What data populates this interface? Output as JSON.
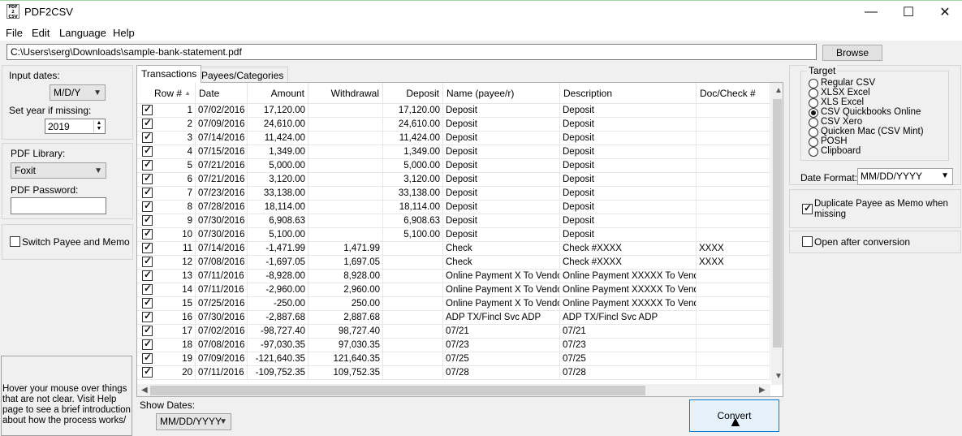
{
  "window": {
    "title": "PDF2CSV",
    "icon_text": "PDF 2 CSV",
    "minimize": "—",
    "maximize": "☐",
    "close": "✕"
  },
  "menu": [
    "File",
    "Edit",
    "Language",
    "Help"
  ],
  "path": {
    "value": "C:\\Users\\serg\\Downloads\\sample-bank-statement.pdf",
    "browse_label": "Browse"
  },
  "left": {
    "input_dates_label": "Input dates:",
    "input_dates_value": "M/D/Y",
    "year_label": "Set year if missing:",
    "year_value": "2019",
    "pdf_library_label": "PDF Library:",
    "pdf_library_value": "Foxit",
    "pdf_password_label": "PDF Password:",
    "pdf_password_value": "",
    "switch_label": "Switch Payee and Memo",
    "switch_checked": false,
    "help_text": "Hover your mouse over things that are not clear. Visit Help page to see a brief introduction about how the process works/"
  },
  "tabs": [
    "Transactions",
    "Payees/Categories"
  ],
  "table": {
    "columns": [
      "Row #",
      "Date",
      "Amount",
      "Withdrawal",
      "Deposit",
      "Name (payee/r)",
      "Description",
      "Doc/Check #"
    ],
    "rows": [
      [
        "1",
        "07/02/2016",
        "17,120.00",
        "",
        "17,120.00",
        "Deposit",
        "Deposit",
        ""
      ],
      [
        "2",
        "07/09/2016",
        "24,610.00",
        "",
        "24,610.00",
        "Deposit",
        "Deposit",
        ""
      ],
      [
        "3",
        "07/14/2016",
        "11,424.00",
        "",
        "11,424.00",
        "Deposit",
        "Deposit",
        ""
      ],
      [
        "4",
        "07/15/2016",
        "1,349.00",
        "",
        "1,349.00",
        "Deposit",
        "Deposit",
        ""
      ],
      [
        "5",
        "07/21/2016",
        "5,000.00",
        "",
        "5,000.00",
        "Deposit",
        "Deposit",
        ""
      ],
      [
        "6",
        "07/21/2016",
        "3,120.00",
        "",
        "3,120.00",
        "Deposit",
        "Deposit",
        ""
      ],
      [
        "7",
        "07/23/2016",
        "33,138.00",
        "",
        "33,138.00",
        "Deposit",
        "Deposit",
        ""
      ],
      [
        "8",
        "07/28/2016",
        "18,114.00",
        "",
        "18,114.00",
        "Deposit",
        "Deposit",
        ""
      ],
      [
        "9",
        "07/30/2016",
        "6,908.63",
        "",
        "6,908.63",
        "Deposit",
        "Deposit",
        ""
      ],
      [
        "10",
        "07/30/2016",
        "5,100.00",
        "",
        "5,100.00",
        "Deposit",
        "Deposit",
        ""
      ],
      [
        "11",
        "07/14/2016",
        "-1,471.99",
        "1,471.99",
        "",
        "Check",
        "Check #XXXX",
        "XXXX"
      ],
      [
        "12",
        "07/08/2016",
        "-1,697.05",
        "1,697.05",
        "",
        "Check",
        "Check #XXXX",
        "XXXX"
      ],
      [
        "13",
        "07/11/2016",
        "-8,928.00",
        "8,928.00",
        "",
        "Online Payment X To Vendor",
        "Online Payment XXXXX To Vendor",
        ""
      ],
      [
        "14",
        "07/11/2016",
        "-2,960.00",
        "2,960.00",
        "",
        "Online Payment X To Vendor",
        "Online Payment XXXXX To Vendor",
        ""
      ],
      [
        "15",
        "07/25/2016",
        "-250.00",
        "250.00",
        "",
        "Online Payment X To Vendor",
        "Online Payment XXXXX To Vendor",
        ""
      ],
      [
        "16",
        "07/30/2016",
        "-2,887.68",
        "2,887.68",
        "",
        "ADP TX/Fincl Svc ADP",
        "ADP TX/Fincl Svc ADP",
        ""
      ],
      [
        "17",
        "07/02/2016",
        "-98,727.40",
        "98,727.40",
        "",
        "07/21",
        "07/21",
        ""
      ],
      [
        "18",
        "07/08/2016",
        "-97,030.35",
        "97,030.35",
        "",
        "07/23",
        "07/23",
        ""
      ],
      [
        "19",
        "07/09/2016",
        "-121,640.35",
        "121,640.35",
        "",
        "07/25",
        "07/25",
        ""
      ],
      [
        "20",
        "07/11/2016",
        "-109,752.35",
        "109,752.35",
        "",
        "07/28",
        "07/28",
        ""
      ]
    ]
  },
  "bottom": {
    "show_dates_label": "Show Dates:",
    "show_dates_value": "MM/DD/YYYY",
    "convert_label": "Convert"
  },
  "target": {
    "legend": "Target",
    "options": [
      "Regular CSV",
      "XLSX Excel",
      "XLS Excel",
      "CSV Quickbooks Online",
      "CSV Xero",
      "Quicken Mac (CSV Mint)",
      "POSH",
      "Clipboard"
    ],
    "selected": "CSV Quickbooks Online",
    "date_format_label": "Date Format:",
    "date_format_value": "MM/DD/YYYY"
  },
  "options": {
    "duplicate_label": "Duplicate Payee as Memo when missing",
    "duplicate_checked": true,
    "open_after_label": "Open after conversion",
    "open_after_checked": false
  }
}
